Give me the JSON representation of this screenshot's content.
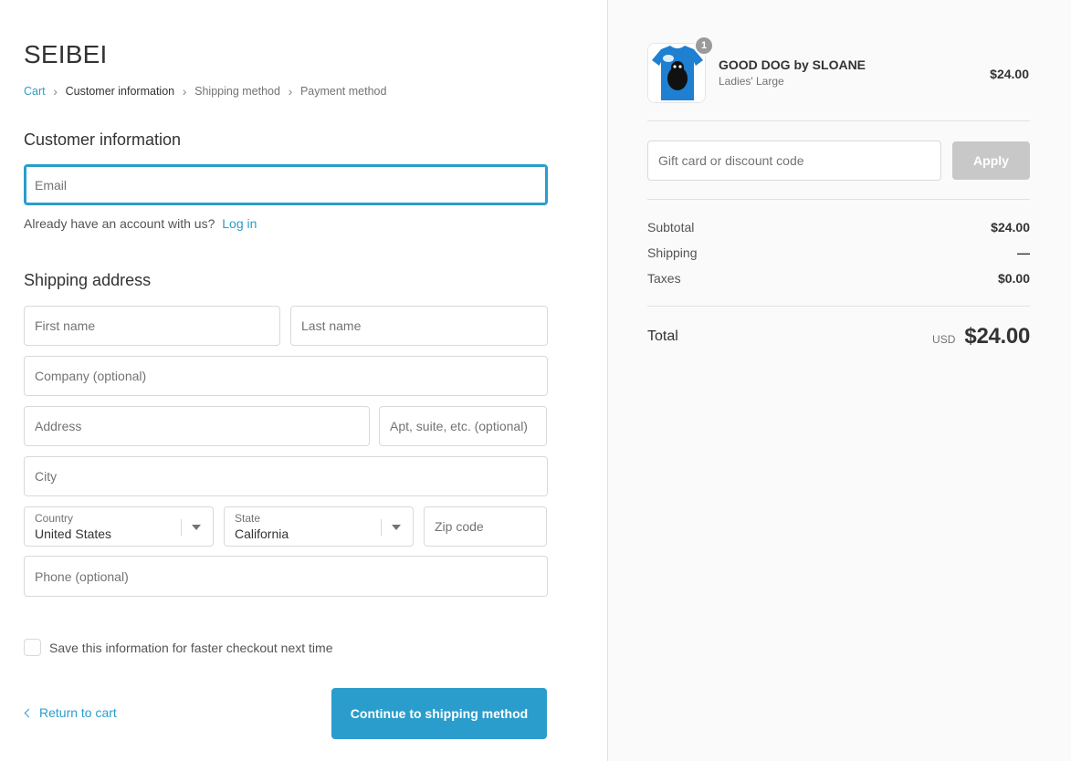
{
  "shop": {
    "name": "SEIBEI"
  },
  "breadcrumb": [
    {
      "label": "Cart"
    },
    {
      "label": "Customer information"
    },
    {
      "label": "Shipping method"
    },
    {
      "label": "Payment method"
    }
  ],
  "customer": {
    "title": "Customer information",
    "email_placeholder": "Email",
    "account_prompt": "Already have an account with us?",
    "login_label": "Log in"
  },
  "shipping": {
    "title": "Shipping address",
    "first_name_placeholder": "First name",
    "last_name_placeholder": "Last name",
    "company_placeholder": "Company (optional)",
    "address_placeholder": "Address",
    "apt_placeholder": "Apt, suite, etc. (optional)",
    "city_placeholder": "City",
    "country_label": "Country",
    "country_value": "United States",
    "state_label": "State",
    "state_value": "California",
    "zip_placeholder": "Zip code",
    "phone_placeholder": "Phone (optional)"
  },
  "save_info": {
    "label": "Save this information for faster checkout next time",
    "checked": false
  },
  "actions": {
    "return_label": "Return to cart",
    "continue_label": "Continue to shipping method"
  },
  "order": {
    "item": {
      "name": "GOOD DOG by SLOANE",
      "variant": "Ladies' Large",
      "price": "$24.00",
      "quantity": "1",
      "thumb_icon": "blue-tshirt-product-image"
    },
    "discount_placeholder": "Gift card or discount code",
    "apply_label": "Apply",
    "subtotal_label": "Subtotal",
    "subtotal_value": "$24.00",
    "shipping_label": "Shipping",
    "shipping_value": "—",
    "taxes_label": "Taxes",
    "taxes_value": "$0.00",
    "total_label": "Total",
    "total_currency": "USD",
    "total_value": "$24.00"
  },
  "colors": {
    "accent": "#2a9dcc",
    "apply_disabled": "#c8c8c8",
    "sidebar_bg": "#fafafa",
    "shirt": "#1f7fd0"
  }
}
